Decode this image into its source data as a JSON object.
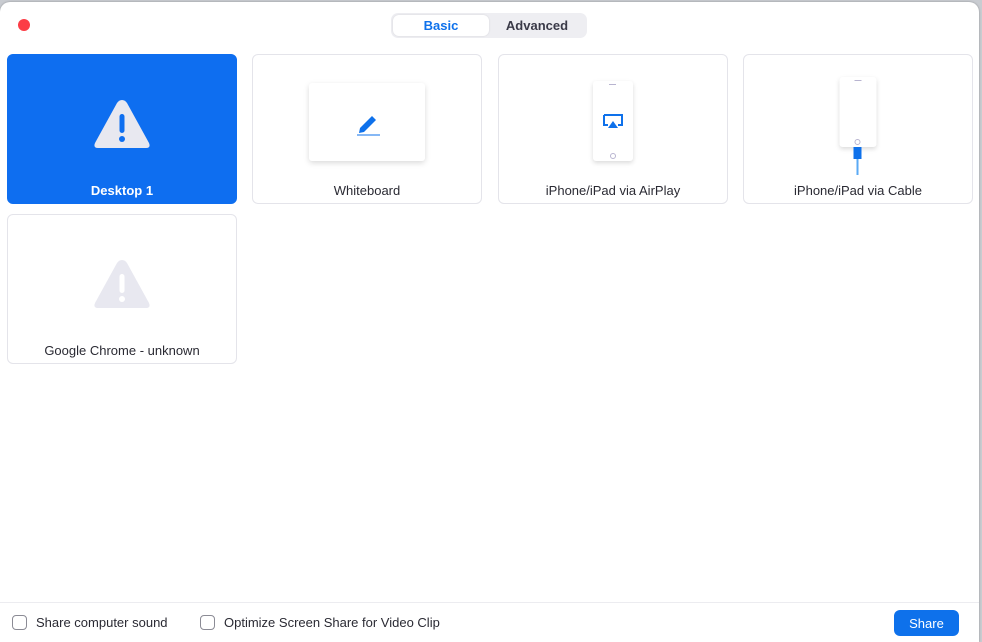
{
  "tabs": [
    {
      "label": "Basic",
      "active": true
    },
    {
      "label": "Advanced",
      "active": false
    }
  ],
  "tiles": [
    {
      "label": "Desktop 1",
      "icon": "warning-icon",
      "selected": true
    },
    {
      "label": "Whiteboard",
      "icon": "pen-icon"
    },
    {
      "label": "iPhone/iPad via AirPlay",
      "icon": "airplay-phone-icon"
    },
    {
      "label": "iPhone/iPad via Cable",
      "icon": "cable-phone-icon"
    },
    {
      "label": "Google Chrome - unknown",
      "icon": "warning-icon"
    }
  ],
  "footer": {
    "share_sound": "Share computer sound",
    "optimize": "Optimize Screen Share for Video Clip",
    "share_button": "Share"
  },
  "colors": {
    "accent": "#0e71eb",
    "close": "#fc3d46"
  }
}
